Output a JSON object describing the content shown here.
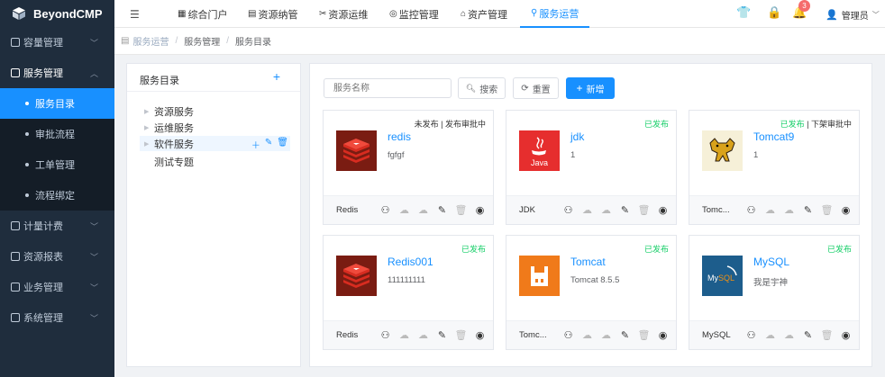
{
  "app": {
    "title": "BeyondCMP"
  },
  "sidebar": {
    "items": [
      {
        "label": "容量管理",
        "expanded": false
      },
      {
        "label": "服务管理",
        "expanded": true,
        "children": [
          {
            "label": "服务目录",
            "active": true
          },
          {
            "label": "审批流程"
          },
          {
            "label": "工单管理"
          },
          {
            "label": "流程绑定"
          }
        ]
      },
      {
        "label": "计量计费",
        "expanded": false
      },
      {
        "label": "资源报表",
        "expanded": false
      },
      {
        "label": "业务管理",
        "expanded": false
      },
      {
        "label": "系统管理",
        "expanded": false
      }
    ]
  },
  "topnav": {
    "tabs": [
      {
        "label": "综合门户",
        "icon": "portal-icon"
      },
      {
        "label": "资源纳管",
        "icon": "database-icon"
      },
      {
        "label": "资源运维",
        "icon": "tools-icon"
      },
      {
        "label": "监控管理",
        "icon": "monitor-icon"
      },
      {
        "label": "资产管理",
        "icon": "home-icon"
      },
      {
        "label": "服务运营",
        "icon": "sitemap-icon",
        "active": true
      }
    ],
    "notification_count": "3",
    "user_label": "管理员"
  },
  "breadcrumb": [
    "服务运营",
    "服务管理",
    "服务目录"
  ],
  "tree": {
    "title": "服务目录",
    "nodes": [
      {
        "label": "资源服务",
        "caret": true
      },
      {
        "label": "运维服务",
        "caret": true
      },
      {
        "label": "软件服务",
        "caret": true,
        "selected": true
      },
      {
        "label": "测试专题",
        "caret": false
      }
    ]
  },
  "toolbar": {
    "search_placeholder": "服务名称",
    "search_label": "搜索",
    "reset_label": "重置",
    "add_label": "新增"
  },
  "services": [
    {
      "name": "redis",
      "desc": "fgfgf",
      "type": "Redis",
      "status": "未发布 | 发布审批中",
      "logo": "redis"
    },
    {
      "name": "jdk",
      "desc": "1",
      "type": "JDK",
      "status": "已发布",
      "logo": "java"
    },
    {
      "name": "Tomcat9",
      "desc": "1",
      "type": "Tomc...",
      "status": "已发布 | 下架审批中",
      "logo": "tomcat9"
    },
    {
      "name": "Redis001",
      "desc": "111111111",
      "type": "Redis",
      "status": "已发布",
      "logo": "redis"
    },
    {
      "name": "Tomcat",
      "desc": "Tomcat 8.5.5",
      "type": "Tomc...",
      "status": "已发布",
      "logo": "tomcat"
    },
    {
      "name": "MySQL",
      "desc": "我是宇神",
      "type": "MySQL",
      "status": "已发布",
      "logo": "mysql"
    }
  ],
  "colors": {
    "primary": "#1890ff",
    "sidebar": "#1f2d3d",
    "success": "#13ce66",
    "badge": "#f56c6c"
  }
}
